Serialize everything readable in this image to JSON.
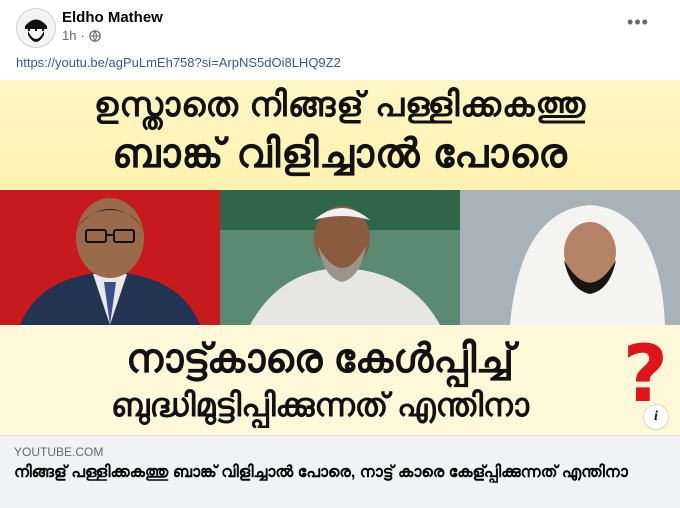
{
  "post": {
    "author": "Eldho Mathew",
    "time": "1h",
    "link": "https://youtu.be/agPuLmEh758?si=ArpNS5dOi8LHQ9Z2"
  },
  "preview": {
    "line1": "ഉസ്താതെ നിങ്ങള് പള്ളിക്കകത്തു",
    "line2": "ബാങ്ക് വിളിച്ചാൽ പോരെ",
    "line3": "നാട്ട്കാരെ കേൾപ്പിച്ച്",
    "line4": "ബുദ്ധിമുട്ടിപ്പിക്കുന്നത് എന്തിനാ",
    "question_mark": "?",
    "info_symbol": "i"
  },
  "card": {
    "domain": "YOUTUBE.COM",
    "title": "നിങ്ങള് പള്ളിക്കകത്തു ബാങ്ക് വിളിച്ചാൽ പോരെ, നാട്ട് കാരെ കേള്പ്പിക്കുന്നത് എന്തിനാ"
  },
  "icons": {
    "globe": "globe-icon",
    "more": "more-options-icon",
    "info": "info-icon"
  }
}
